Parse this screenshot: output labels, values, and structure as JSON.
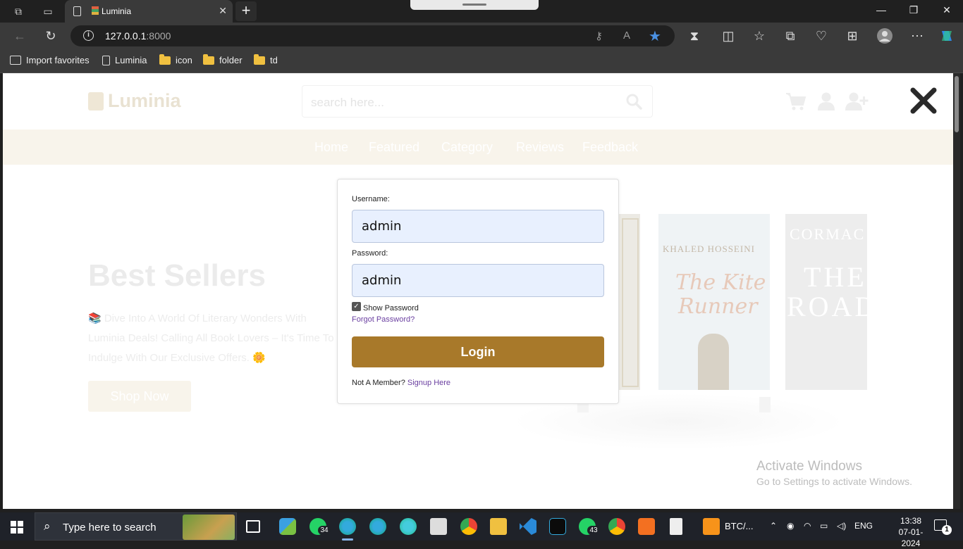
{
  "browser": {
    "tab_title": "Luminia",
    "url_host": "127.0.0.1",
    "url_port": ":8000",
    "favorites": [
      {
        "label": "Import favorites"
      },
      {
        "label": "Luminia"
      },
      {
        "label": "icon"
      },
      {
        "label": "folder"
      },
      {
        "label": "td"
      }
    ]
  },
  "site": {
    "logo": "Luminia",
    "search_placeholder": "search here...",
    "nav": [
      "Home",
      "Featured",
      "Category",
      "Reviews",
      "Feedback"
    ],
    "hero_title": "Best Sellers",
    "hero_text": "📚 Dive Into A World Of Literary Wonders With Luminia Deals! Calling All Book Lovers – It's Time To Indulge With Our Exclusive Offers. 🌼",
    "shop_button": "Shop Now",
    "books": {
      "kite_author": "KHALED HOSSEINI",
      "kite_title_1": "The Kite",
      "kite_title_2": "Runner",
      "road_author": "CORMAC McCARTHY",
      "road_title_1": "THE",
      "road_title_2": "ROAD"
    }
  },
  "login": {
    "username_label": "Username:",
    "username_value": "admin",
    "password_label": "Password:",
    "password_value": "admin",
    "show_password": "Show Password",
    "show_password_checked": true,
    "forgot": "Forgot Password?",
    "button": "Login",
    "member_text": "Not A Member?",
    "signup": "Signup Here"
  },
  "watermark": {
    "line1": "Activate Windows",
    "line2": "Go to Settings to activate Windows."
  },
  "taskbar": {
    "search_text": "Type here to search",
    "whatsapp_badge_1": "34",
    "whatsapp_badge_2": "43",
    "btc_label": "BTC/...",
    "lang": "ENG",
    "time": "13:38",
    "date": "07-01-2024",
    "notifications": "1"
  },
  "colors": {
    "accent": "#a8792a",
    "input_bg": "#e8f0fe",
    "link": "#6a3fa0",
    "nav_bg": "#f8f4eb"
  }
}
